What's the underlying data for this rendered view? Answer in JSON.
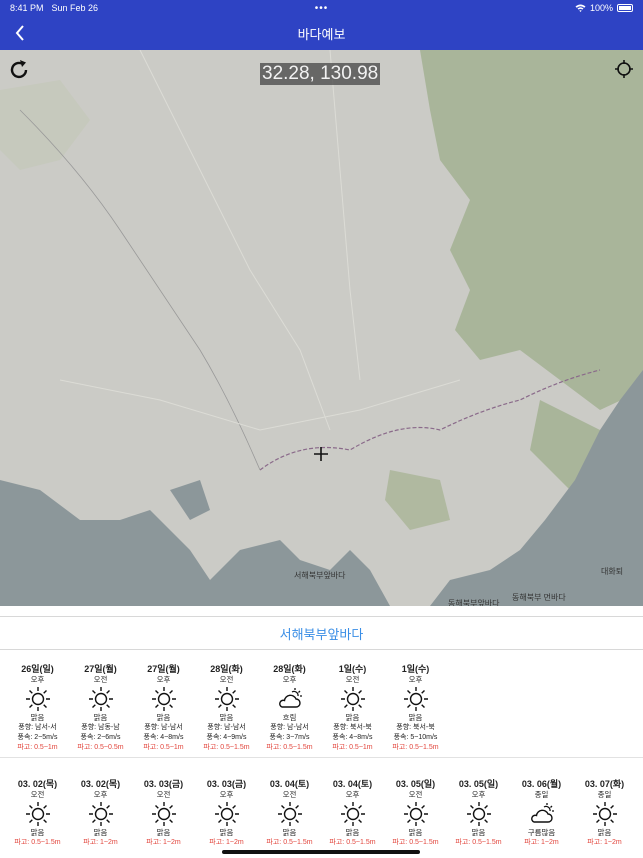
{
  "status_bar": {
    "time": "8:41 PM",
    "date": "Sun Feb 26",
    "dots": "•••",
    "battery": "100%"
  },
  "nav": {
    "title": "바다예보",
    "back_icon": "chevron-left-icon"
  },
  "map": {
    "coordinates": "32.28, 130.98",
    "labels": [
      {
        "text": "서해북부앞바다",
        "name": "label-west-sea"
      },
      {
        "text": "동해북부앞바다",
        "name": "label-east-sea-near"
      },
      {
        "text": "동해북부 먼바다",
        "name": "label-east-sea-far"
      },
      {
        "text": "대화퇴",
        "name": "label-daehwatoe"
      }
    ]
  },
  "region_title": "서해북부앞바다",
  "forecast_row1": [
    {
      "date": "26일(일)",
      "period": "오후",
      "icon": "sun",
      "cond": "맑음",
      "wind_dir": "풍향: 남서-서",
      "wind_speed": "풍속: 2~5m/s",
      "wave": "파고: 0.5~1m"
    },
    {
      "date": "27일(월)",
      "period": "오전",
      "icon": "sun",
      "cond": "맑음",
      "wind_dir": "풍향: 남동-남",
      "wind_speed": "풍속: 2~6m/s",
      "wave": "파고: 0.5~0.5m"
    },
    {
      "date": "27일(월)",
      "period": "오후",
      "icon": "sun",
      "cond": "맑음",
      "wind_dir": "풍향: 남-남서",
      "wind_speed": "풍속: 4~8m/s",
      "wave": "파고: 0.5~1m"
    },
    {
      "date": "28일(화)",
      "period": "오전",
      "icon": "sun",
      "cond": "맑음",
      "wind_dir": "풍향: 남-남서",
      "wind_speed": "풍속: 4~9m/s",
      "wave": "파고: 0.5~1.5m"
    },
    {
      "date": "28일(화)",
      "period": "오후",
      "icon": "cloud",
      "cond": "흐림",
      "wind_dir": "풍향: 남-남서",
      "wind_speed": "풍속: 3~7m/s",
      "wave": "파고: 0.5~1.5m"
    },
    {
      "date": "1일(수)",
      "period": "오전",
      "icon": "sun",
      "cond": "맑음",
      "wind_dir": "풍향: 북서-북",
      "wind_speed": "풍속: 4~8m/s",
      "wave": "파고: 0.5~1m"
    },
    {
      "date": "1일(수)",
      "period": "오후",
      "icon": "sun",
      "cond": "맑음",
      "wind_dir": "풍향: 북서-북",
      "wind_speed": "풍속: 5~10m/s",
      "wave": "파고: 0.5~1.5m"
    }
  ],
  "forecast_row2": [
    {
      "date": "03. 02(목)",
      "period": "오전",
      "icon": "sun",
      "cond": "맑음",
      "wave": "파고: 0.5~1.5m"
    },
    {
      "date": "03. 02(목)",
      "period": "오후",
      "icon": "sun",
      "cond": "맑음",
      "wave": "파고: 1~2m"
    },
    {
      "date": "03. 03(금)",
      "period": "오전",
      "icon": "sun",
      "cond": "맑음",
      "wave": "파고: 1~2m"
    },
    {
      "date": "03. 03(금)",
      "period": "오후",
      "icon": "sun",
      "cond": "맑음",
      "wave": "파고: 1~2m"
    },
    {
      "date": "03. 04(토)",
      "period": "오전",
      "icon": "sun",
      "cond": "맑음",
      "wave": "파고: 0.5~1.5m"
    },
    {
      "date": "03. 04(토)",
      "period": "오후",
      "icon": "sun",
      "cond": "맑음",
      "wave": "파고: 0.5~1.5m"
    },
    {
      "date": "03. 05(일)",
      "period": "오전",
      "icon": "sun",
      "cond": "맑음",
      "wave": "파고: 0.5~1.5m"
    },
    {
      "date": "03. 05(일)",
      "period": "오후",
      "icon": "sun",
      "cond": "맑음",
      "wave": "파고: 0.5~1.5m"
    },
    {
      "date": "03. 06(월)",
      "period": "종일",
      "icon": "cloud",
      "cond": "구름많음",
      "wave": "파고: 1~2m"
    },
    {
      "date": "03. 07(화)",
      "period": "종일",
      "icon": "sun",
      "cond": "맑음",
      "wave": "파고: 1~2m"
    }
  ],
  "colors": {
    "nav": "#2e43c4",
    "accent": "#3a8ee6",
    "wave": "#e2453c"
  }
}
